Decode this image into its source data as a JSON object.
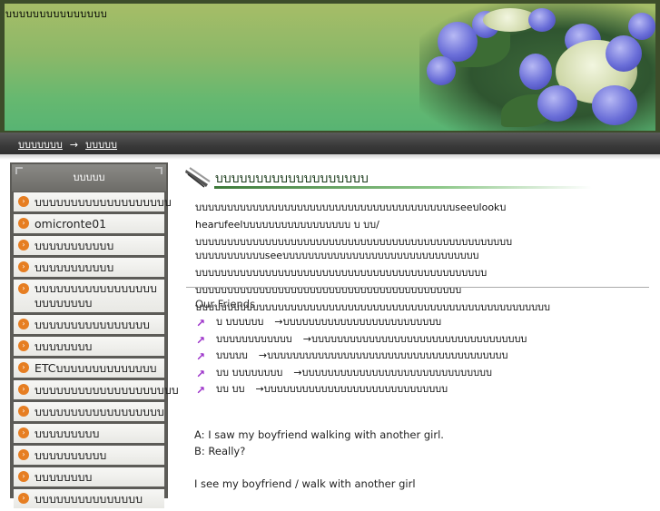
{
  "header": {
    "site_title": "บบบบบบบบบบบบบบบ"
  },
  "breadcrumb": {
    "home": "บบบบบบบ",
    "separator": "→",
    "current": "บบบบบ"
  },
  "sidebar": {
    "title": "บบบบบ",
    "items": [
      {
        "label": "บบบบบบบบบบบบบบบบบบบ"
      },
      {
        "label": "omicronte01"
      },
      {
        "label": "บบบบบบบบบบบ"
      },
      {
        "label": "บบบบบบบบบบบ"
      },
      {
        "label": "บบบบบบบบบบบบบบบบบบบบบบบบบ"
      },
      {
        "label": "บบบบบบบบบบบบบบบบ"
      },
      {
        "label": "บบบบบบบบ"
      },
      {
        "label": "ETCบบบบบบบบบบบบบบ"
      },
      {
        "label": "บบบบบบบบบบบบบบบบบบบบ"
      },
      {
        "label": "บบบบบบบบบบบบบบบบบบ"
      },
      {
        "label": "บบบบบบบบบ"
      },
      {
        "label": "บบบบบบบบบบ"
      },
      {
        "label": "บบบบบบบบ"
      },
      {
        "label": "บบบบบบบบบบบบบบบ"
      }
    ]
  },
  "main": {
    "title": "บบบบบบบบบบบบบบบบบบบ",
    "para1": "บบบบบบบบบบบบบบบบบบบบบบบบบบบบบบบบบบบบบบบบบseeบlookบ hearบfeelบบบบบบบบบบบบบบบบบ บ บบ/บบบบบบบบบบบบบบบบบบบบบบบบบบบบบบบบบบบบบบบบบบบบบบบบบบ",
    "para2": "บบบบบบบบบบบseeบบบบบบบบบบบบบบบบบบบบบบบบบบบบบบบ บบบบบบบบบบบบบบบบบบบบบบบบบบบบบบบบบบบบบบบบบบบบบบ บบบบบบบบบบบบบบบบบบบบบบบบบบบบบบบบบบบบบบบบบบ บบบบบบบบบบบบบบบบบบบบบบบบบบบบบบบบบบบบบบบบบบบบบบบบบบบบบบบบ",
    "friends_label": "Our Friends",
    "friends": [
      {
        "name": "บ บบบบบบ",
        "desc": "→บบบบบบบบบบบบบบบบบบบบบบบบบ"
      },
      {
        "name": "บบบบบบบบบบบบ",
        "desc": "→บบบบบบบบบบบบบบบบบบบบบบบบบบบบบบบบบบ"
      },
      {
        "name": "บบบบบ",
        "desc": "→บบบบบบบบบบบบบบบบบบบบบบบบบบบบบบบบบบบบบบ"
      },
      {
        "name": "บบ บบบบบบบบ",
        "desc": "→บบบบบบบบบบบบบบบบบบบบบบบบบบบบบบ"
      },
      {
        "name": "บบ บบ",
        "desc": "→บบบบบบบบบบบบบบบบบบบบบบบบบบบบบ"
      }
    ],
    "english1": "A: I saw my boyfriend walking with another girl.",
    "english2": "B: Really?",
    "english3": "I see my boyfriend / walk with another girl"
  },
  "colors": {
    "header_green": "#66b870",
    "navbar": "#3a3a3a",
    "sidebar_bg": "#5c5b57",
    "bullet_orange": "#e67e22",
    "friend_arrow_purple": "#9b2fc9"
  }
}
